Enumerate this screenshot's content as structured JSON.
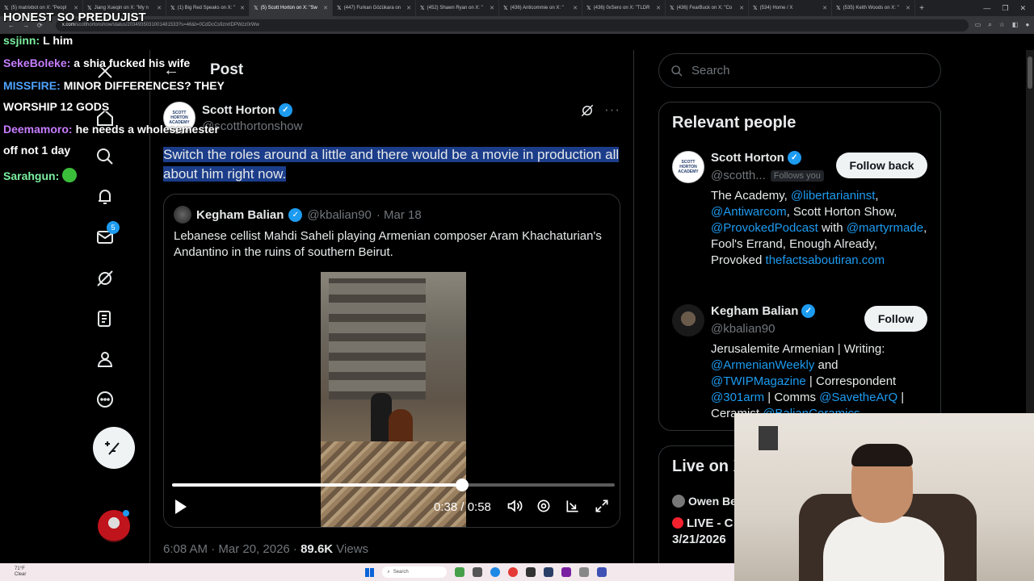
{
  "browser": {
    "tabs": [
      {
        "label": "(5) matrixbot on X: \"Peopl",
        "active": false
      },
      {
        "label": "Jiang Xueqin on X: \"My n",
        "active": false
      },
      {
        "label": "(1) Big Red Speaks on X: \"",
        "active": false
      },
      {
        "label": "(5) Scott Horton on X: \"Sw",
        "active": true
      },
      {
        "label": "(447) Furkan Gözükara on",
        "active": false
      },
      {
        "label": "(452) Shawn Ryan on X: \"",
        "active": false
      },
      {
        "label": "(436) Anticommie on X: \"",
        "active": false
      },
      {
        "label": "(436) 0xSero on X: \"TLDR",
        "active": false
      },
      {
        "label": "(436) FearBuck on X: \"Co",
        "active": false
      },
      {
        "label": "(534) Home / X",
        "active": false
      },
      {
        "label": "(535) Keith Woods on X: \"",
        "active": false
      }
    ],
    "url_host": "x.com",
    "url_path": "/scotthortonshow/status/2034935031001481533?s=46&t=0CdDcCs9znrtDPWzz0rWw"
  },
  "nav": {
    "badge_messages": "5",
    "icons": [
      "home-icon",
      "search-icon",
      "bell-icon",
      "mail-icon",
      "grok-icon",
      "lists-icon",
      "profile-icon",
      "more-icon"
    ]
  },
  "header": {
    "back": "←",
    "title": "Post"
  },
  "post": {
    "author_name": "Scott Horton",
    "author_handle": "@scotthortonshow",
    "avatar_text": "SCOTT HORTON ACADEMY",
    "text": "Switch the roles around a little and there would be a movie in production all about him right now.",
    "more": "···",
    "quote": {
      "name": "Kegham Balian",
      "handle": "@kbalian90",
      "date": "· Mar 18",
      "text": "Lebanese cellist Mahdi Saheli playing Armenian composer Aram Khachaturian's Andantino in the ruins of southern Beirut.",
      "video": {
        "elapsed": "0:38",
        "duration": "0:58",
        "time_label": "0:38 / 0:58",
        "progress": 0.655
      }
    },
    "timestamp": "6:08 AM · Mar 20, 2026 · ",
    "views_count": "89.6K",
    "views_label": " Views"
  },
  "right": {
    "search_placeholder": "Search",
    "relevant_title": "Relevant people",
    "people": [
      {
        "name": "Scott Horton",
        "handle": "@scotth...",
        "follows_you": "Follows you",
        "button": "Follow back",
        "bio": [
          {
            "t": "The Academy, ",
            "link": false
          },
          {
            "t": "@libertarianinst",
            "link": true
          },
          {
            "t": ", ",
            "link": false
          },
          {
            "t": "@Antiwarcom",
            "link": true
          },
          {
            "t": ", Scott Horton Show, ",
            "link": false
          },
          {
            "t": "@ProvokedPodcast",
            "link": true
          },
          {
            "t": " with ",
            "link": false
          },
          {
            "t": "@martyrmade",
            "link": true
          },
          {
            "t": ", Fool's Errand, Enough Already, Provoked ",
            "link": false
          },
          {
            "t": "thefactsaboutiran.com",
            "link": true
          }
        ]
      },
      {
        "name": "Kegham Balian",
        "handle": "@kbalian90",
        "button": "Follow",
        "bio": [
          {
            "t": "Jerusalemite Armenian | Writing: ",
            "link": false
          },
          {
            "t": "@ArmenianWeekly",
            "link": true
          },
          {
            "t": " and ",
            "link": false
          },
          {
            "t": "@TWIPMagazine",
            "link": true
          },
          {
            "t": " | Correspondent ",
            "link": false
          },
          {
            "t": "@301arm",
            "link": true
          },
          {
            "t": " | Comms ",
            "link": false
          },
          {
            "t": "@SavetheArQ",
            "link": true
          },
          {
            "t": " | Ceramist ",
            "link": false
          },
          {
            "t": "@BalianCeramics",
            "link": true
          }
        ]
      }
    ],
    "live_title": "Live on X",
    "live_host": "Owen Be",
    "live_text_1": "LIVE - C",
    "live_text_2": "3/21/2026"
  },
  "overlay": {
    "stream_title": "HONEST SO PREDUJIST",
    "chat": [
      {
        "user": "ssjinn:",
        "color": "#7cf0a0",
        "msg": "L him"
      },
      {
        "user": "SekeBoleke:",
        "color": "#c77dff",
        "msg": "a shia fucked his wife"
      },
      {
        "user": "MISSFIRE:",
        "color": "#4fa3ff",
        "msg": "MINOR DIFFERENCES? THEY"
      },
      {
        "user": "",
        "color": "#ffffff",
        "msg": "WORSHIP 12 GODS"
      },
      {
        "user": "Deemamoro:",
        "color": "#c77dff",
        "msg": "he needs a wholesemester"
      },
      {
        "user": "",
        "color": "#ffffff",
        "msg": "off not 1 day"
      },
      {
        "user": "Sarahgun:",
        "color": "#7cf0a0",
        "msg": ""
      }
    ]
  },
  "taskbar": {
    "weather_temp": "71°F",
    "weather_cond": "Clear",
    "search": "Search"
  },
  "colors": {
    "accent": "#1d9bf0",
    "selection": "#1b3d8a",
    "live_red": "#f4212e"
  }
}
